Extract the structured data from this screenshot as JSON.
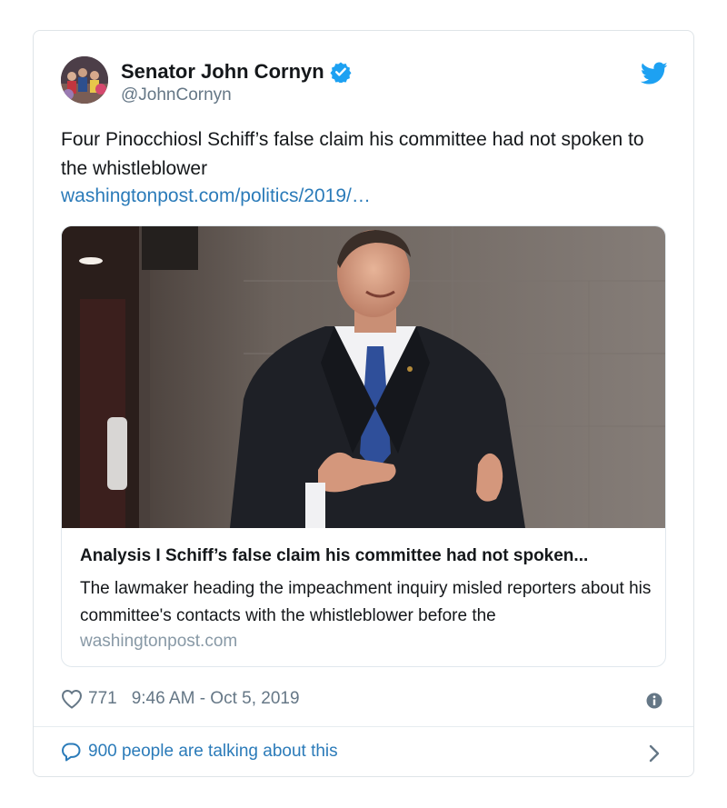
{
  "tweet": {
    "author_name": "Senator John Cornyn",
    "author_handle": "@JohnCornyn",
    "text": "Four Pinocchiosl Schiff’s false claim his committee had not spoken to the whistleblower",
    "link_text": "washingtonpost.com/politics/2019/…",
    "likes": "771",
    "timestamp": "9:46 AM - Oct 5, 2019",
    "talking": "900 people are talking about this"
  },
  "card": {
    "title": "Analysis I Schiff’s false claim his committee had not spoken...",
    "description": "The lawmaker heading the impeachment inquiry misled reporters about his committee's contacts with the whistleblower before the",
    "domain": "washingtonpost.com"
  },
  "colors": {
    "link": "#2b7bb9",
    "twitter_blue": "#1da1f2",
    "muted": "#657786",
    "border": "#dfe4e8"
  },
  "icons": {
    "verified": "verified-badge-icon",
    "bird": "twitter-bird-icon",
    "like": "heart-icon",
    "info": "info-icon",
    "reply": "speech-bubble-icon",
    "chevron": "chevron-right-icon"
  }
}
